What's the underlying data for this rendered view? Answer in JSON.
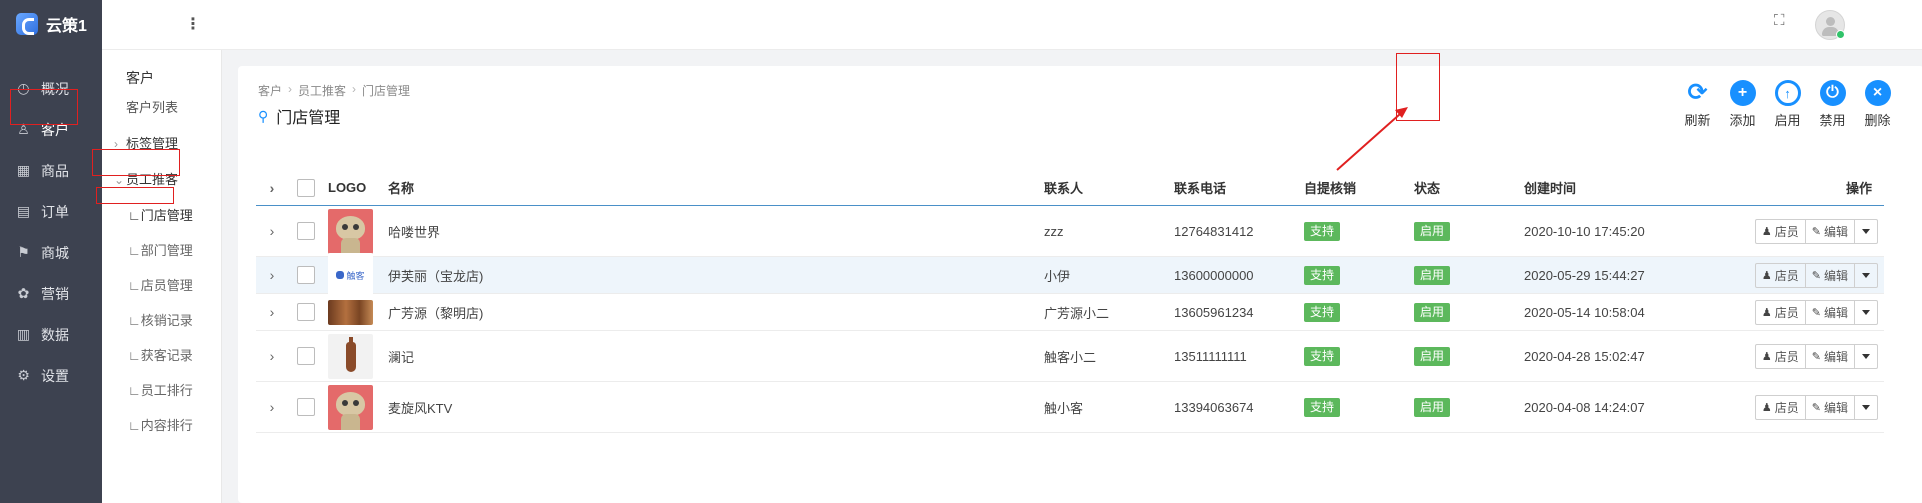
{
  "app": {
    "name": "云策1"
  },
  "nav": {
    "items": [
      {
        "label": "概况",
        "icon": "dashboard-icon",
        "glyph": "◴"
      },
      {
        "label": "客户",
        "icon": "customer-icon",
        "glyph": "♙"
      },
      {
        "label": "商品",
        "icon": "grid-icon",
        "glyph": "▦"
      },
      {
        "label": "订单",
        "icon": "calendar-icon",
        "glyph": "▤"
      },
      {
        "label": "商城",
        "icon": "shop-flag-icon",
        "glyph": "⚑"
      },
      {
        "label": "营销",
        "icon": "marketing-icon",
        "glyph": "✿"
      },
      {
        "label": "数据",
        "icon": "bar-chart-icon",
        "glyph": "▥"
      },
      {
        "label": "设置",
        "icon": "gear-icon",
        "glyph": "⚙"
      }
    ]
  },
  "subnav": {
    "title": "客户",
    "items": [
      {
        "label": "客户列表",
        "type": "link"
      },
      {
        "label": "标签管理",
        "type": "group",
        "caret": "›"
      },
      {
        "label": "员工推客",
        "type": "group",
        "caret": "⌄"
      },
      {
        "label": "∟门店管理",
        "type": "leaf"
      },
      {
        "label": "∟部门管理",
        "type": "leaf"
      },
      {
        "label": "∟店员管理",
        "type": "leaf"
      },
      {
        "label": "∟核销记录",
        "type": "leaf"
      },
      {
        "label": "∟获客记录",
        "type": "leaf"
      },
      {
        "label": "∟员工排行",
        "type": "leaf"
      },
      {
        "label": "∟内容排行",
        "type": "leaf"
      }
    ]
  },
  "header": {
    "menu_glyph": "⋮",
    "fullscreen_glyph": "⛶"
  },
  "breadcrumb": [
    "客户",
    "员工推客",
    "门店管理"
  ],
  "breadcrumb_sep": "›",
  "page_title": "门店管理",
  "toolbar": [
    {
      "label": "刷新",
      "icon": "refresh-icon",
      "glyph": "⟳",
      "style": "plain"
    },
    {
      "label": "添加",
      "icon": "add-icon",
      "glyph": "+",
      "style": "fill"
    },
    {
      "label": "启用",
      "icon": "upload-enable-icon",
      "glyph": "↑",
      "style": "ring"
    },
    {
      "label": "禁用",
      "icon": "power-icon",
      "glyph": "⏻",
      "style": "fill"
    },
    {
      "label": "删除",
      "icon": "delete-icon",
      "glyph": "×",
      "style": "fill"
    }
  ],
  "table": {
    "columns": [
      "LOGO",
      "名称",
      "联系人",
      "联系电话",
      "自提核销",
      "状态",
      "创建时间",
      "操作"
    ],
    "rows": [
      {
        "logo": "cat",
        "name": "哈喽世界",
        "contact": "zzz",
        "phone": "12764831412",
        "self_pickup": "支持",
        "status": "启用",
        "created": "2020-10-10 17:45:20"
      },
      {
        "logo": "brand",
        "logo_text": "触客",
        "name": "伊芙丽（宝龙店)",
        "contact": "小伊",
        "phone": "13600000000",
        "self_pickup": "支持",
        "status": "启用",
        "created": "2020-05-29 15:44:27"
      },
      {
        "logo": "wood",
        "name": "广芳源（黎明店)",
        "contact": "广芳源小二",
        "phone": "13605961234",
        "self_pickup": "支持",
        "status": "启用",
        "created": "2020-05-14 10:58:04"
      },
      {
        "logo": "bottle",
        "name": "澜记",
        "contact": "触客小二",
        "phone": "13511111111",
        "self_pickup": "支持",
        "status": "启用",
        "created": "2020-04-28 15:02:47"
      },
      {
        "logo": "cat",
        "name": "麦旋风KTV",
        "contact": "触小客",
        "phone": "13394063674",
        "self_pickup": "支持",
        "status": "启用",
        "created": "2020-04-08 14:24:07"
      }
    ],
    "row_actions": {
      "staff": "店员",
      "edit": "编辑",
      "staff_glyph": "♟",
      "edit_glyph": "✎"
    },
    "expand_glyph": "›"
  },
  "colors": {
    "accent": "#1890ff",
    "success": "#5cb85c",
    "nav_bg": "#3d4250",
    "annotation": "#e02020"
  }
}
